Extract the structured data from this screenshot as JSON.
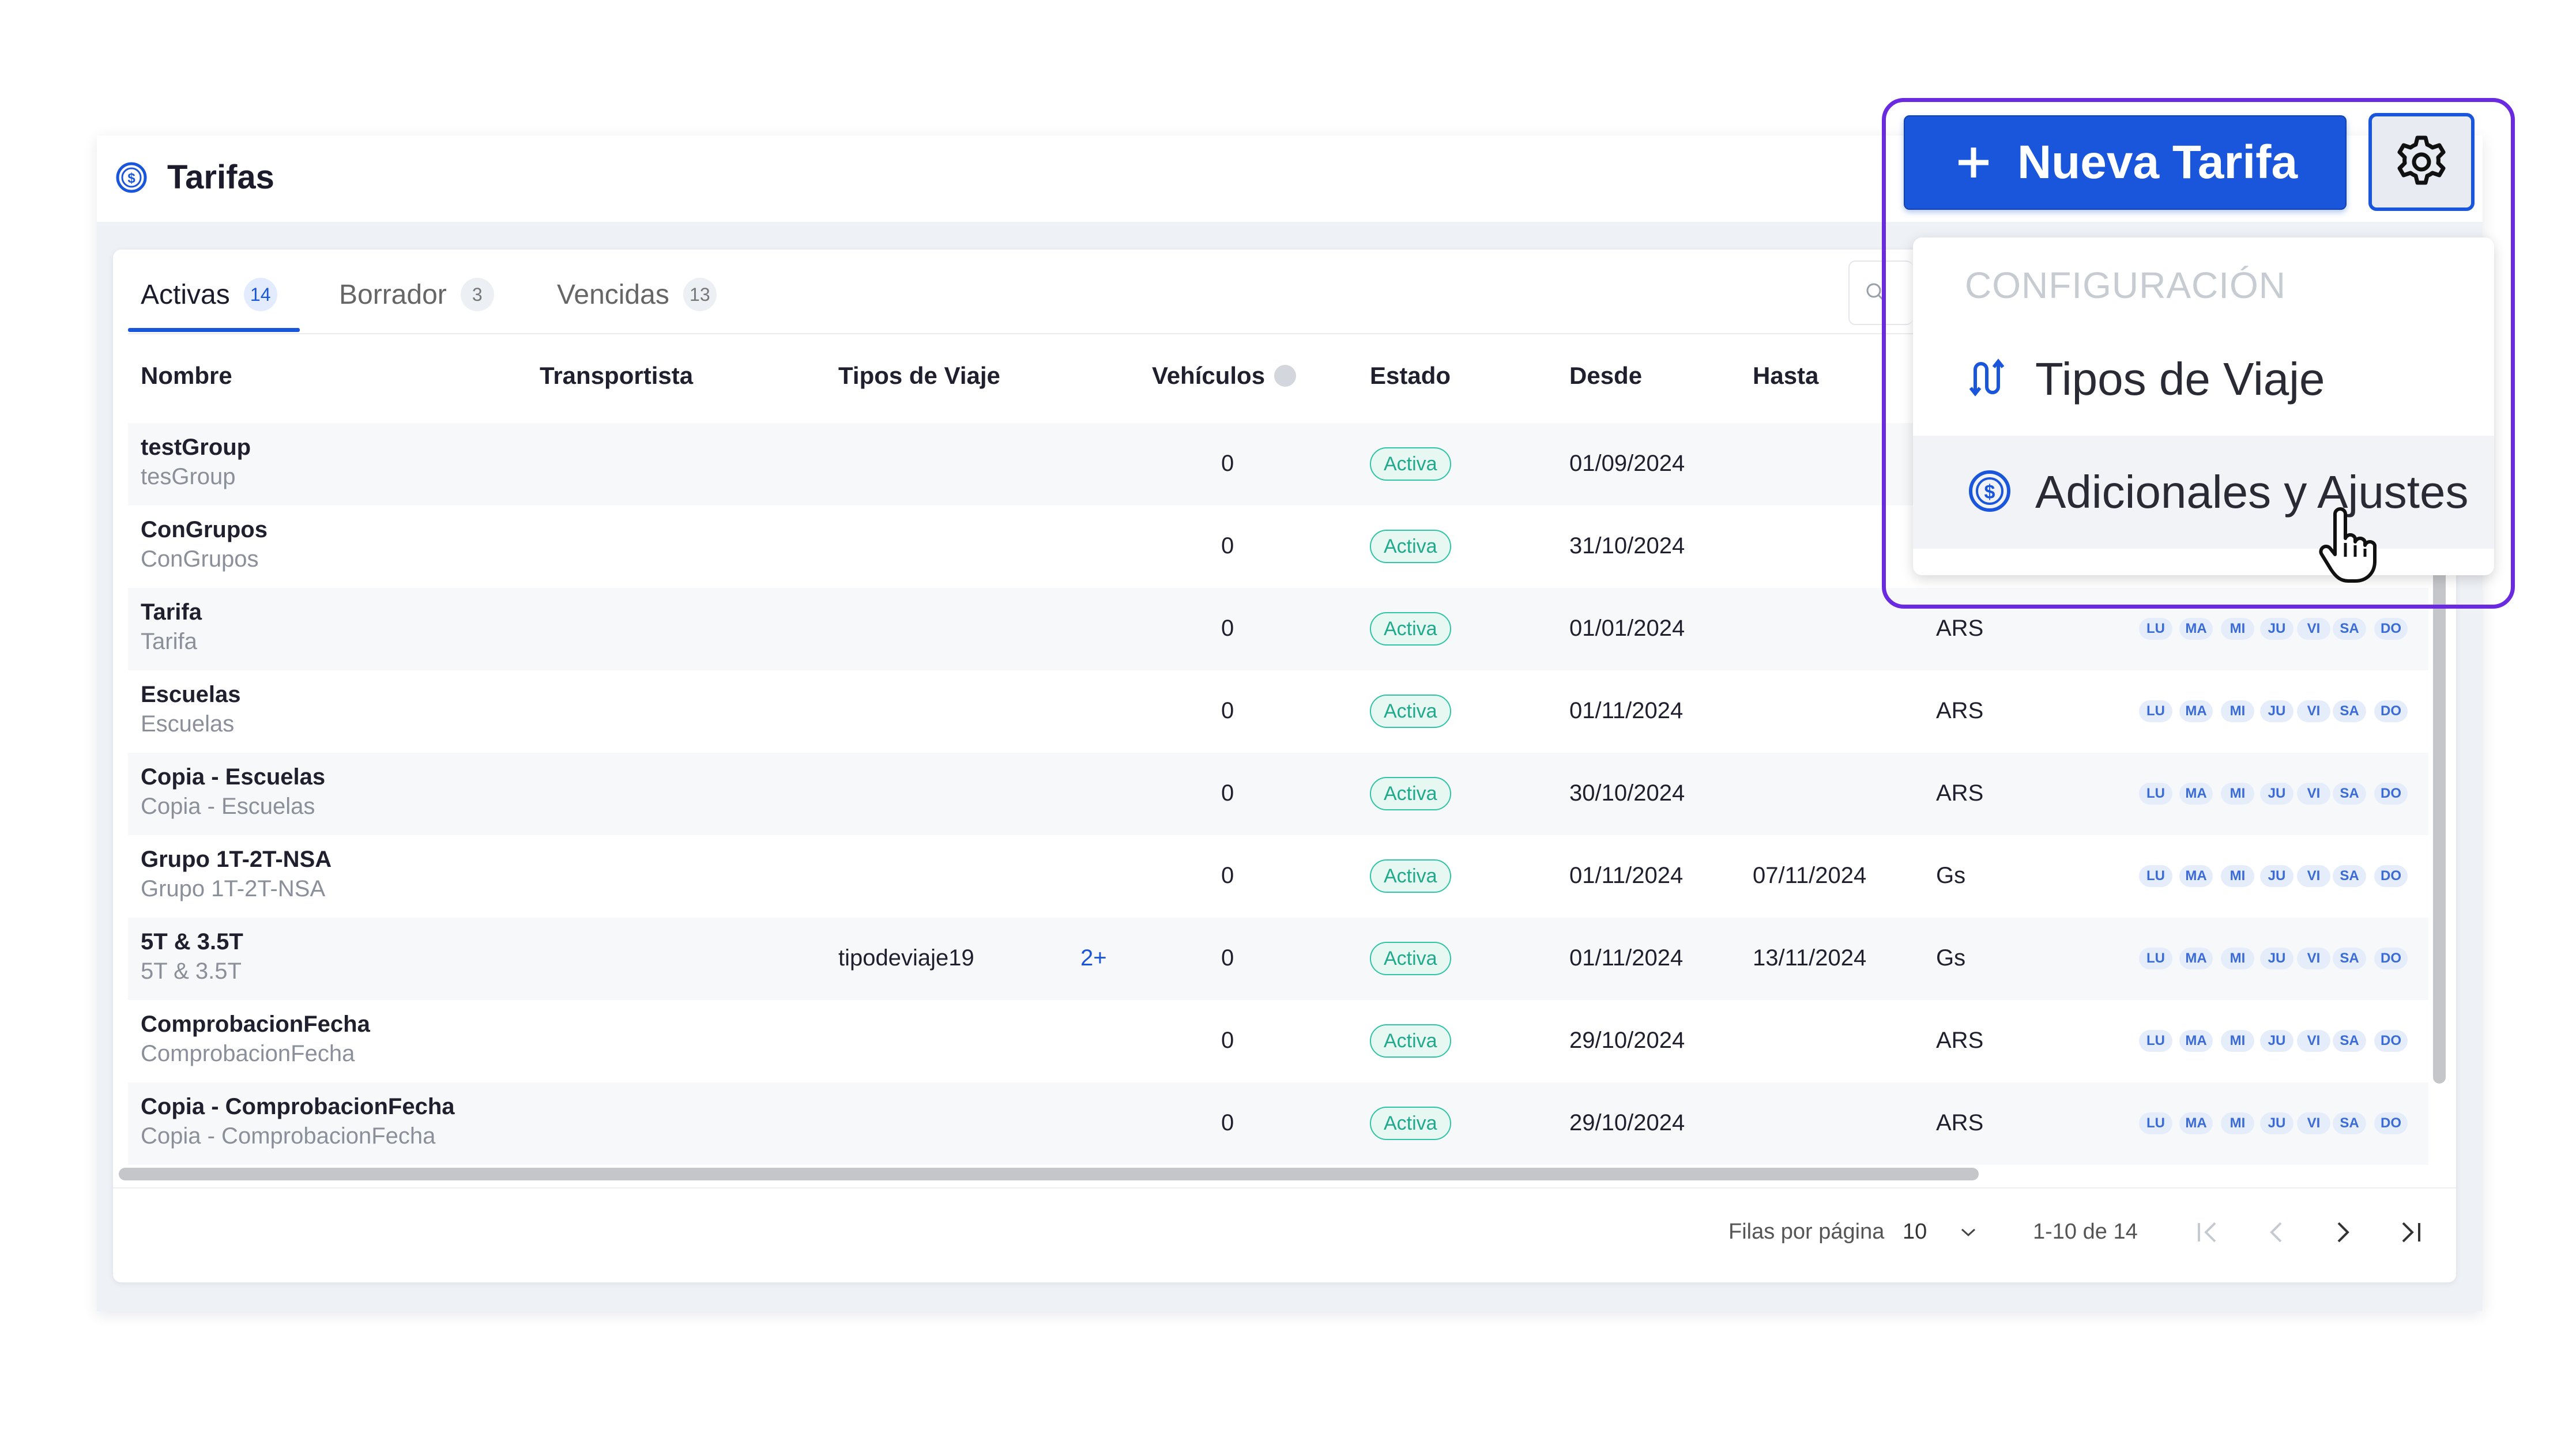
{
  "header": {
    "title": "Tarifas",
    "icon": "dollar-circle-icon"
  },
  "tabs": [
    {
      "label": "Activas",
      "count": "14"
    },
    {
      "label": "Borrador",
      "count": "3"
    },
    {
      "label": "Vencidas",
      "count": "13"
    }
  ],
  "columns": {
    "nombre": "Nombre",
    "transportista": "Transportista",
    "tipos": "Tipos de Viaje",
    "vehiculos": "Vehículos",
    "estado": "Estado",
    "desde": "Desde",
    "hasta": "Hasta"
  },
  "days": [
    "LU",
    "MA",
    "MI",
    "JU",
    "VI",
    "SA",
    "DO"
  ],
  "rows": [
    {
      "name": "testGroup",
      "sub": "tesGroup",
      "tipos": "",
      "more": "",
      "vehiculos": "0",
      "estado": "Activa",
      "desde": "01/09/2024",
      "hasta": "",
      "moneda": ""
    },
    {
      "name": "ConGrupos",
      "sub": "ConGrupos",
      "tipos": "",
      "more": "",
      "vehiculos": "0",
      "estado": "Activa",
      "desde": "31/10/2024",
      "hasta": "",
      "moneda": ""
    },
    {
      "name": "Tarifa",
      "sub": "Tarifa",
      "tipos": "",
      "more": "",
      "vehiculos": "0",
      "estado": "Activa",
      "desde": "01/01/2024",
      "hasta": "",
      "moneda": "ARS"
    },
    {
      "name": "Escuelas",
      "sub": "Escuelas",
      "tipos": "",
      "more": "",
      "vehiculos": "0",
      "estado": "Activa",
      "desde": "01/11/2024",
      "hasta": "",
      "moneda": "ARS"
    },
    {
      "name": "Copia - Escuelas",
      "sub": "Copia - Escuelas",
      "tipos": "",
      "more": "",
      "vehiculos": "0",
      "estado": "Activa",
      "desde": "30/10/2024",
      "hasta": "",
      "moneda": "ARS"
    },
    {
      "name": "Grupo 1T-2T-NSA",
      "sub": "Grupo 1T-2T-NSA",
      "tipos": "",
      "more": "",
      "vehiculos": "0",
      "estado": "Activa",
      "desde": "01/11/2024",
      "hasta": "07/11/2024",
      "moneda": "Gs"
    },
    {
      "name": "5T & 3.5T",
      "sub": "5T & 3.5T",
      "tipos": "tipodeviaje19",
      "more": "2+",
      "vehiculos": "0",
      "estado": "Activa",
      "desde": "01/11/2024",
      "hasta": "13/11/2024",
      "moneda": "Gs"
    },
    {
      "name": "ComprobacionFecha",
      "sub": "ComprobacionFecha",
      "tipos": "",
      "more": "",
      "vehiculos": "0",
      "estado": "Activa",
      "desde": "29/10/2024",
      "hasta": "",
      "moneda": "ARS"
    },
    {
      "name": "Copia - ComprobacionFecha",
      "sub": "Copia - ComprobacionFecha",
      "tipos": "",
      "more": "",
      "vehiculos": "0",
      "estado": "Activa",
      "desde": "29/10/2024",
      "hasta": "",
      "moneda": "ARS"
    }
  ],
  "pagination": {
    "rows_label": "Filas por página",
    "rows_value": "10",
    "range": "1-10 de 14"
  },
  "actions": {
    "new_label": "Nueva Tarifa",
    "menu_section": "CONFIGURACIÓN",
    "menu_items": [
      {
        "label": "Tipos de Viaje",
        "icon": "route-icon"
      },
      {
        "label": "Adicionales y Ajustes",
        "icon": "dollar-circle-icon"
      }
    ]
  },
  "colors": {
    "primary": "#1a56db",
    "accent_outline": "#6a2ae0",
    "active_badge": "#2ec4a5"
  }
}
